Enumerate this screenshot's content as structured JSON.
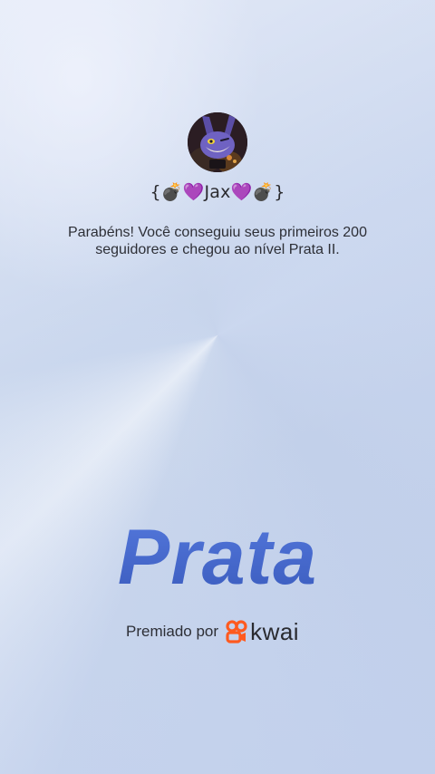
{
  "profile": {
    "username": "{💣💜Jax💜💣}",
    "avatar_icon": "jax-avatar"
  },
  "achievement": {
    "message": "Parabéns! Você conseguiu seus primeiros 200 seguidores e chegou ao nível Prata II.",
    "level_name": "Prata"
  },
  "footer": {
    "awarded_by_label": "Premiado por",
    "brand_name": "kwai",
    "brand_color": "#ff5a1f"
  },
  "theme": {
    "level_color": "#4163c3"
  }
}
